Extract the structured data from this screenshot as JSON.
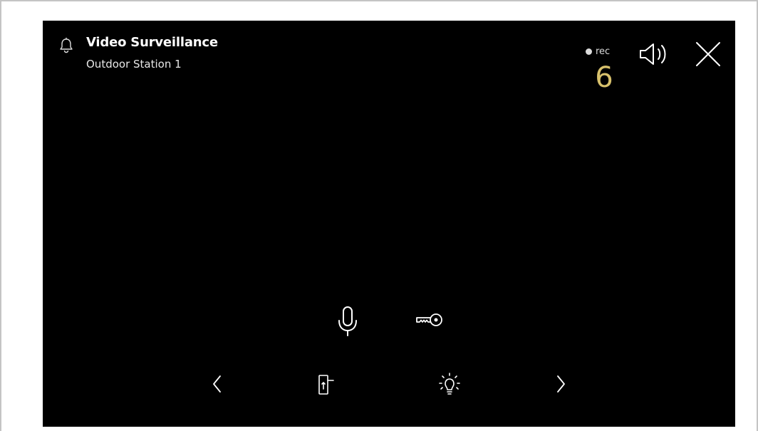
{
  "header": {
    "title": "Video Surveillance",
    "subtitle": "Outdoor Station 1",
    "icon": "bell-icon"
  },
  "recording": {
    "label": "rec",
    "countdown": "6",
    "countdown_color": "#d8c16c"
  },
  "controls": {
    "speaker_icon": "speaker-icon",
    "close_icon": "close-icon",
    "microphone_icon": "microphone-icon",
    "key_icon": "key-icon",
    "previous_icon": "chevron-left-icon",
    "door_icon": "door-icon",
    "light_icon": "light-bulb-icon",
    "next_icon": "chevron-right-icon"
  },
  "colors": {
    "background": "#000000",
    "foreground": "#ffffff",
    "accent": "#d8c16c"
  }
}
